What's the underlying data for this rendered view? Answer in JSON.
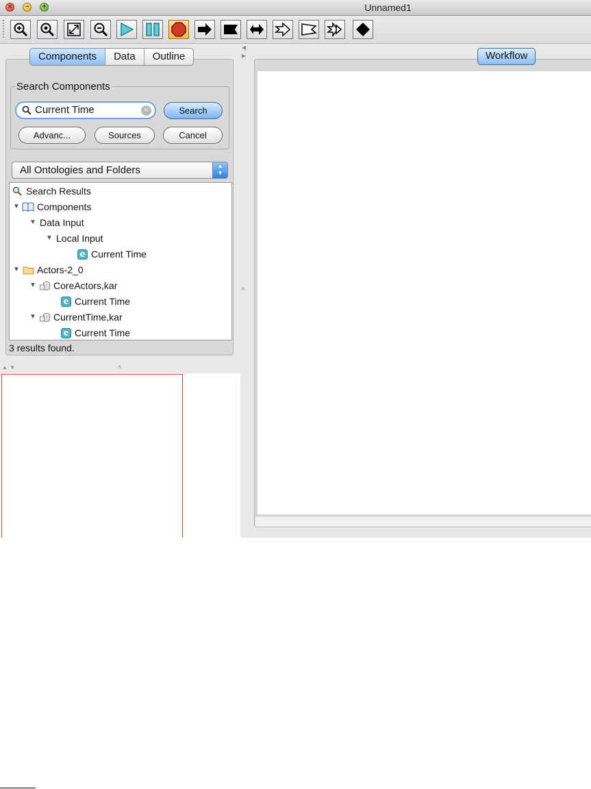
{
  "window": {
    "title": "Unnamed1"
  },
  "toolbar": {
    "buttons": [
      {
        "name": "zoom-in-icon"
      },
      {
        "name": "zoom-reset-icon"
      },
      {
        "name": "fit-to-window-icon"
      },
      {
        "name": "zoom-out-icon"
      },
      {
        "name": "run-icon"
      },
      {
        "name": "pause-icon"
      },
      {
        "name": "stop-icon",
        "active": true
      },
      {
        "name": "arrow-right-icon"
      },
      {
        "name": "flag-icon"
      },
      {
        "name": "arrow-double-icon"
      },
      {
        "name": "outline-arrow-icon"
      },
      {
        "name": "outline-flag-icon"
      },
      {
        "name": "outline-double-arrow-icon"
      },
      {
        "name": "diamond-icon"
      }
    ]
  },
  "left_panel": {
    "tabs": [
      "Components",
      "Data",
      "Outline"
    ],
    "selected_tab": "Components",
    "search_group_label": "Search Components",
    "search_value": "Current Time",
    "search_button": "Search",
    "advanced_button": "Advanc...",
    "sources_button": "Sources",
    "cancel_button": "Cancel",
    "ontology_select": "All Ontologies and Folders",
    "tree": [
      {
        "label": "Search Results"
      },
      {
        "label": "Components"
      },
      {
        "label": "Data Input"
      },
      {
        "label": "Local Input"
      },
      {
        "label": "Current Time"
      },
      {
        "label": "Actors-2_0"
      },
      {
        "label": "CoreActors,kar"
      },
      {
        "label": "Current Time"
      },
      {
        "label": "CurrentTime,kar"
      },
      {
        "label": "Current Time"
      }
    ],
    "status": "3 results found."
  },
  "right_panel": {
    "tab": "Workflow"
  },
  "colors": {
    "accent_blue": "#8fc0f4",
    "stop_red": "#d23a2a",
    "overview_border": "#e23b3b",
    "clock_icon": "#4ab6c6"
  }
}
